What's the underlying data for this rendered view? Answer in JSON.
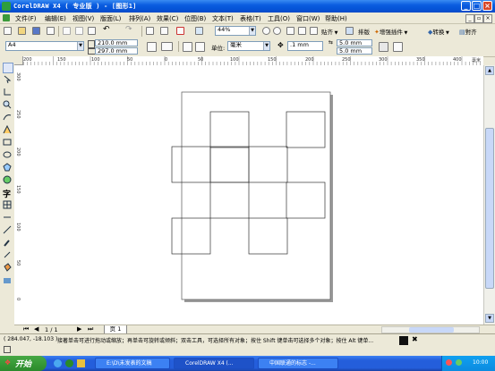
{
  "window": {
    "title": "CorelDRAW X4 ( 专业版 ) - [图形1]",
    "brand_color": "#0A5DE0"
  },
  "menu": {
    "items": [
      "文件(F)",
      "编辑(E)",
      "视图(V)",
      "版面(L)",
      "排列(A)",
      "效果(C)",
      "位图(B)",
      "文本(T)",
      "表格(T)",
      "工具(O)",
      "窗口(W)",
      "帮助(H)"
    ]
  },
  "toolbar": {
    "zoom_value": "44%",
    "snap_label": "贴齐",
    "enhance_label": "增强插件",
    "convert_label": "转换",
    "align_label": "對齐",
    "arrange_label": "排版"
  },
  "property_bar": {
    "paper_size": "A4",
    "width": "210.0 mm",
    "height": "297.0 mm",
    "units_label": "单位:",
    "units_value": "毫米",
    "nudge": ".1 mm",
    "dup_x": "5.0 mm",
    "dup_y": "5.0 mm"
  },
  "ruler": {
    "top_labels": [
      "200",
      "150",
      "100",
      "50",
      "0",
      "50",
      "100",
      "150",
      "200",
      "250",
      "300",
      "350",
      "400"
    ],
    "unit": "毫米",
    "left_labels": [
      "300",
      "250",
      "200",
      "150",
      "100",
      "50",
      "0"
    ]
  },
  "page_nav": {
    "position": "1 / 1",
    "tab": "页 1"
  },
  "status": {
    "coords": "( 284.047, -18.103 )",
    "message": "接著单击可进行拖动或缩放；再单击可旋转或倾斜；双击工具，可选择所有对象；按住 Shift 键单击可选择多个对象；按住 Alt 键单..."
  },
  "taskbar": {
    "start_label": "开始",
    "tasks": [
      "E:\\D\\未发表的文稿",
      "CorelDRAW X4 (...",
      "中国联通的标志 -..."
    ],
    "time": "10:00"
  },
  "colors": {
    "canvas": "#FFFFFF",
    "chrome": "#ECE9D8",
    "taskbar": "#245EDB",
    "start": "#379A36"
  }
}
